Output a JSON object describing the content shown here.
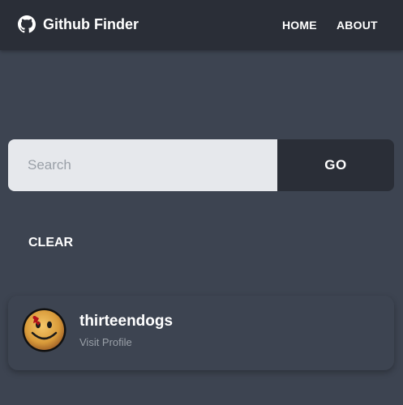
{
  "navbar": {
    "title": "Github Finder",
    "logo_icon": "github-icon",
    "links": [
      {
        "label": "HOME"
      },
      {
        "label": "ABOUT"
      }
    ],
    "background": "#2a2e37"
  },
  "search": {
    "placeholder": "Search",
    "value": "",
    "go_label": "GO"
  },
  "clear_label": "CLEAR",
  "users": [
    {
      "username": "thirteendogs",
      "link_label": "Visit Profile",
      "avatar_icon": "smiley-face-avatar"
    }
  ],
  "colors": {
    "page_background": "#3d4451",
    "input_background": "#e6e8ec",
    "muted_text": "#9aa0a8"
  }
}
